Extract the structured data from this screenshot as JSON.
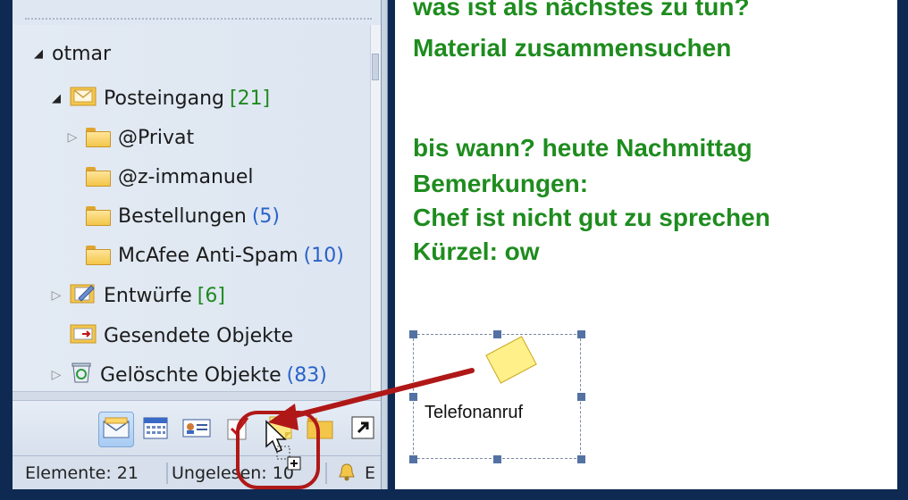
{
  "nav": {
    "account": "otmar",
    "folders": [
      {
        "label": "Posteingang",
        "count": "[21]"
      },
      {
        "label": "@Privat",
        "count": ""
      },
      {
        "label": "@z-immanuel",
        "count": ""
      },
      {
        "label": "Bestellungen",
        "count": "(5)"
      },
      {
        "label": "McAfee Anti-Spam",
        "count": "(10)"
      },
      {
        "label": "Entwürfe",
        "count": "[6]"
      },
      {
        "label": "Gesendete Objekte",
        "count": ""
      },
      {
        "label": "Gelöschte Objekte",
        "count": "(83)"
      }
    ],
    "buttons": [
      "mail-icon",
      "calendar-icon",
      "contacts-icon",
      "tasks-icon",
      "notes-icon",
      "folder-icon",
      "shortcut-icon"
    ]
  },
  "status": {
    "items_label": "Elemente: 21",
    "unread_label": "Ungelesen: 10",
    "reminder_label": "E"
  },
  "document": {
    "lines": [
      "was ist als nächstes zu tun?",
      "Material zusammensuchen",
      "bis wann? heute Nachmittag",
      "Bemerkungen:",
      "Chef ist nicht gut zu sprechen",
      "Kürzel: ow"
    ],
    "embed_label": "Telefonanruf"
  },
  "colors": {
    "doc_text": "#1e8c1e",
    "count_green": "#1f8a1f",
    "count_blue": "#2a62c9",
    "annotation_red": "#b01818",
    "frame": "#0e2a52"
  }
}
